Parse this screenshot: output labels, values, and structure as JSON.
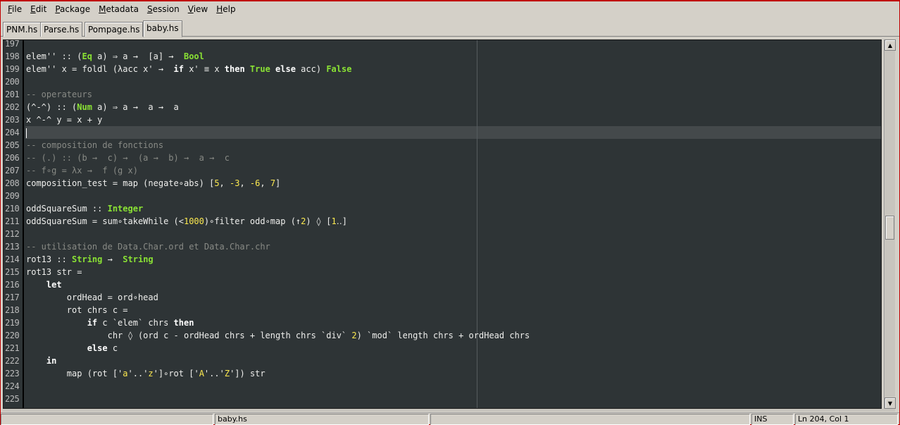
{
  "menubar": {
    "items": [
      {
        "label": "File",
        "mnemonic": "F",
        "rest": "ile"
      },
      {
        "label": "Edit",
        "mnemonic": "E",
        "rest": "dit"
      },
      {
        "label": "Package",
        "mnemonic": "P",
        "rest": "ackage"
      },
      {
        "label": "Metadata",
        "mnemonic": "M",
        "rest": "etadata"
      },
      {
        "label": "Session",
        "mnemonic": "S",
        "rest": "ession"
      },
      {
        "label": "View",
        "mnemonic": "V",
        "rest": "iew"
      },
      {
        "label": "Help",
        "mnemonic": "H",
        "rest": "elp"
      }
    ]
  },
  "tabs": [
    {
      "label": "PNM.hs",
      "active": false
    },
    {
      "label": "Parse.hs",
      "active": false
    },
    {
      "label": "Pompage.hs",
      "active": false
    },
    {
      "label": "baby.hs",
      "active": true
    }
  ],
  "editor": {
    "current_line": "204",
    "colors": {
      "background": "#2e3436",
      "keyword": "#ffffff",
      "type": "#8ae234",
      "comment": "#888a85",
      "number": "#fce94f"
    },
    "lines": [
      {
        "n": "197",
        "tokens": []
      },
      {
        "n": "198",
        "tokens": [
          [
            "",
            "elem'' :: ("
          ],
          [
            "ty",
            "Eq"
          ],
          [
            "",
            " a) ⇒ a →  [a] →  "
          ],
          [
            "ty",
            "Bool"
          ]
        ]
      },
      {
        "n": "199",
        "tokens": [
          [
            "",
            "elem'' x = foldl (λacc x' →  "
          ],
          [
            "kw",
            "if"
          ],
          [
            "",
            " x' ≡ x "
          ],
          [
            "kw",
            "then"
          ],
          [
            "",
            " "
          ],
          [
            "ty",
            "True"
          ],
          [
            "",
            " "
          ],
          [
            "kw",
            "else"
          ],
          [
            "",
            " acc) "
          ],
          [
            "ty",
            "False"
          ]
        ]
      },
      {
        "n": "200",
        "tokens": []
      },
      {
        "n": "201",
        "tokens": [
          [
            "cm",
            "-- operateurs"
          ]
        ]
      },
      {
        "n": "202",
        "tokens": [
          [
            "",
            "(^-^) :: ("
          ],
          [
            "ty",
            "Num"
          ],
          [
            "",
            " a) ⇒ a →  a →  a"
          ]
        ]
      },
      {
        "n": "203",
        "tokens": [
          [
            "",
            "x ^-^ y = x + y"
          ]
        ]
      },
      {
        "n": "204",
        "tokens": [
          [
            "cursor",
            ""
          ]
        ]
      },
      {
        "n": "205",
        "tokens": [
          [
            "cm",
            "-- composition de fonctions"
          ]
        ]
      },
      {
        "n": "206",
        "tokens": [
          [
            "cm",
            "-- (.) :: (b →  c) →  (a →  b) →  a →  c"
          ]
        ]
      },
      {
        "n": "207",
        "tokens": [
          [
            "cm",
            "-- f∘g = λx →  f (g x)"
          ]
        ]
      },
      {
        "n": "208",
        "tokens": [
          [
            "",
            "composition_test = map (negate∘abs) ["
          ],
          [
            "nm",
            "5"
          ],
          [
            "",
            ", "
          ],
          [
            "nm",
            "-3"
          ],
          [
            "",
            ", "
          ],
          [
            "nm",
            "-6"
          ],
          [
            "",
            ", "
          ],
          [
            "nm",
            "7"
          ],
          [
            "",
            "]"
          ]
        ]
      },
      {
        "n": "209",
        "tokens": []
      },
      {
        "n": "210",
        "tokens": [
          [
            "",
            "oddSquareSum :: "
          ],
          [
            "ty",
            "Integer"
          ]
        ]
      },
      {
        "n": "211",
        "tokens": [
          [
            "",
            "oddSquareSum = sum∘takeWhile (<"
          ],
          [
            "nm",
            "1000"
          ],
          [
            "",
            ")∘filter odd∘map (↑"
          ],
          [
            "nm",
            "2"
          ],
          [
            "",
            ") ◊ ["
          ],
          [
            "nm",
            "1"
          ],
          [
            "",
            "‥]"
          ]
        ]
      },
      {
        "n": "212",
        "tokens": []
      },
      {
        "n": "213",
        "tokens": [
          [
            "cm",
            "-- utilisation de Data.Char.ord et Data.Char.chr"
          ]
        ]
      },
      {
        "n": "214",
        "tokens": [
          [
            "",
            "rot13 :: "
          ],
          [
            "ty",
            "String"
          ],
          [
            "",
            " →  "
          ],
          [
            "ty",
            "String"
          ]
        ]
      },
      {
        "n": "215",
        "tokens": [
          [
            "",
            "rot13 str ="
          ]
        ]
      },
      {
        "n": "216",
        "tokens": [
          [
            "",
            "    "
          ],
          [
            "kw",
            "let"
          ]
        ]
      },
      {
        "n": "217",
        "tokens": [
          [
            "",
            "        ordHead = ord∘head"
          ]
        ]
      },
      {
        "n": "218",
        "tokens": [
          [
            "",
            "        rot chrs c ="
          ]
        ]
      },
      {
        "n": "219",
        "tokens": [
          [
            "",
            "            "
          ],
          [
            "kw",
            "if"
          ],
          [
            "",
            " c `elem` chrs "
          ],
          [
            "kw",
            "then"
          ]
        ]
      },
      {
        "n": "220",
        "tokens": [
          [
            "",
            "                chr ◊ (ord c - ordHead chrs + length chrs `div` "
          ],
          [
            "nm",
            "2"
          ],
          [
            "",
            ") `mod` length chrs + ordHead chrs"
          ]
        ]
      },
      {
        "n": "221",
        "tokens": [
          [
            "",
            "            "
          ],
          [
            "kw",
            "else"
          ],
          [
            "",
            " c"
          ]
        ]
      },
      {
        "n": "222",
        "tokens": [
          [
            "",
            "    "
          ],
          [
            "kw",
            "in"
          ]
        ]
      },
      {
        "n": "223",
        "tokens": [
          [
            "",
            "        map (rot ['"
          ],
          [
            "st",
            "a"
          ],
          [
            "",
            "'..'"
          ],
          [
            "st",
            "z"
          ],
          [
            "",
            "']∘rot ['"
          ],
          [
            "st",
            "A"
          ],
          [
            "",
            "'..'"
          ],
          [
            "st",
            "Z"
          ],
          [
            "",
            "']) str"
          ]
        ]
      },
      {
        "n": "224",
        "tokens": []
      },
      {
        "n": "225",
        "tokens": []
      }
    ]
  },
  "statusbar": {
    "filename": "baby.hs",
    "mode": "INS",
    "position": "Ln 204, Col  1"
  }
}
